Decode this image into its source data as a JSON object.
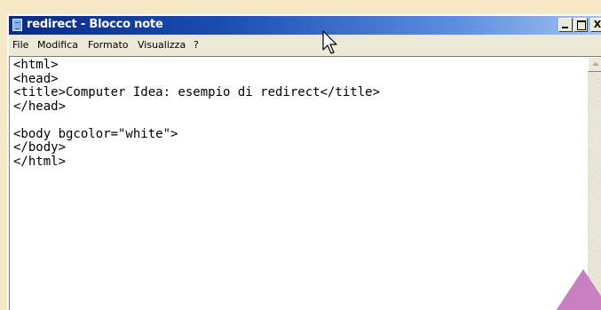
{
  "window": {
    "title": "redirect - Blocco note",
    "controls": {
      "minimize_icon": "minimize-icon",
      "maximize_icon": "maximize-icon",
      "close_label": "X"
    }
  },
  "menubar": {
    "items": [
      "File",
      "Modifica",
      "Formato",
      "Visualizza",
      "?"
    ]
  },
  "editor": {
    "content": "<html>\n<head>\n<title>Computer Idea: esempio di redirect</title>\n</head>\n\n<body bgcolor=\"white\">\n</body>\n</html>"
  },
  "colors": {
    "titlebar_dark": "#0a2a86",
    "titlebar_light": "#a6c3ee",
    "page_background": "#f4e7c6",
    "decoration": "#c77fbf"
  },
  "icons": {
    "app": "notepad-icon",
    "cursor": "mouse-pointer-icon",
    "scroll_up": "scroll-up-arrow-icon",
    "decoration": "triangle-decoration-icon"
  }
}
